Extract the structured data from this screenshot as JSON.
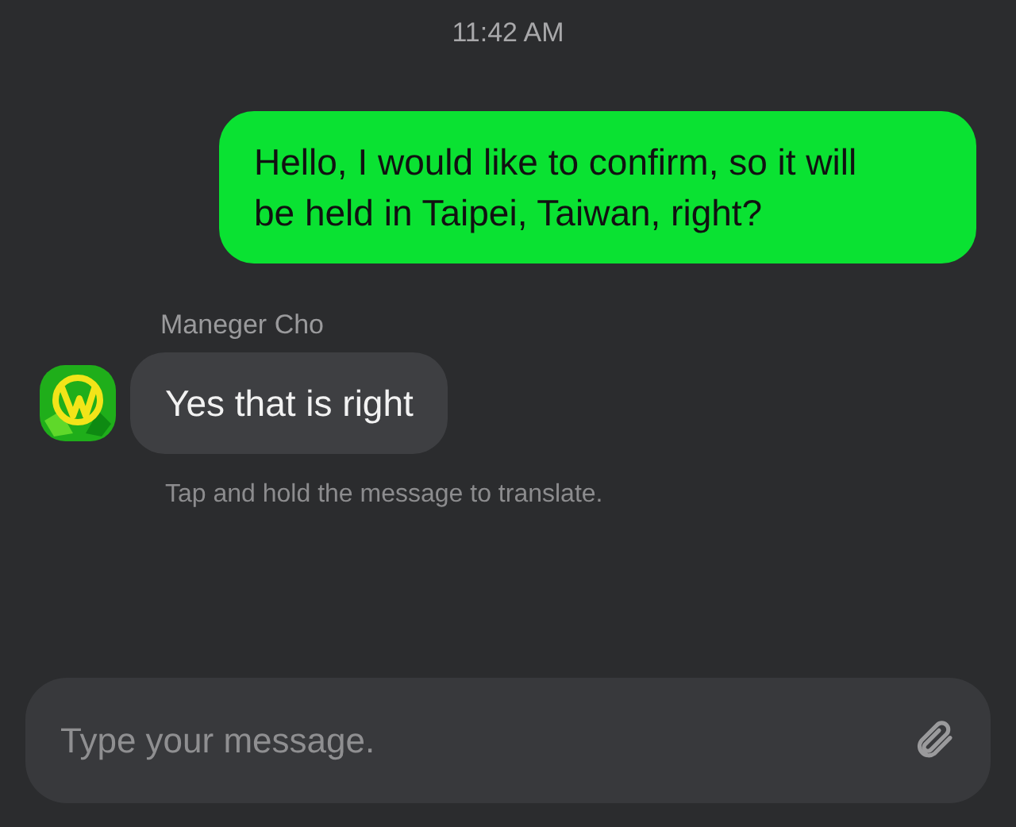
{
  "timestamp": "11:42 AM",
  "messages": [
    {
      "kind": "outgoing",
      "text": "Hello, I would like to confirm, so it will be held in Taipei, Taiwan, right?"
    },
    {
      "kind": "incoming",
      "sender": "Maneger Cho",
      "text": "Yes that is right"
    }
  ],
  "hint": "Tap and hold the message to translate.",
  "composer": {
    "placeholder": "Type your message."
  }
}
